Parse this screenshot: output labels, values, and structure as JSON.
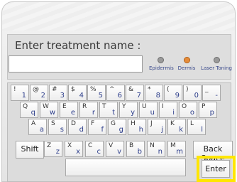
{
  "header": {
    "title": "Enter treatment name :",
    "input_value": "",
    "modes": [
      {
        "label": "Epidermis",
        "active": false
      },
      {
        "label": "Dermis",
        "active": true
      },
      {
        "label": "Laser Toning",
        "active": false
      }
    ]
  },
  "keyboard": {
    "row1": [
      {
        "shift": "!",
        "main": "1"
      },
      {
        "shift": "@",
        "main": "2"
      },
      {
        "shift": "#",
        "main": "3"
      },
      {
        "shift": "$",
        "main": "4"
      },
      {
        "shift": "%",
        "main": "5"
      },
      {
        "shift": "^",
        "main": "6"
      },
      {
        "shift": "&",
        "main": "7"
      },
      {
        "shift": "*",
        "main": "8"
      },
      {
        "shift": "(",
        "main": "9"
      },
      {
        "shift": ")",
        "main": "0"
      },
      {
        "shift": "_",
        "main": "-"
      }
    ],
    "row2": [
      {
        "shift": "Q",
        "main": "q"
      },
      {
        "shift": "W",
        "main": "w"
      },
      {
        "shift": "E",
        "main": "e"
      },
      {
        "shift": "R",
        "main": "r"
      },
      {
        "shift": "T",
        "main": "t"
      },
      {
        "shift": "Y",
        "main": "y"
      },
      {
        "shift": "U",
        "main": "u"
      },
      {
        "shift": "I",
        "main": "i"
      },
      {
        "shift": "O",
        "main": "o"
      },
      {
        "shift": "P",
        "main": "p"
      }
    ],
    "row3": [
      {
        "shift": "A",
        "main": "a"
      },
      {
        "shift": "S",
        "main": "s"
      },
      {
        "shift": "D",
        "main": "d"
      },
      {
        "shift": "F",
        "main": "f"
      },
      {
        "shift": "G",
        "main": "g"
      },
      {
        "shift": "H",
        "main": "h"
      },
      {
        "shift": "J",
        "main": "j"
      },
      {
        "shift": "K",
        "main": "k"
      },
      {
        "shift": "L",
        "main": "l"
      }
    ],
    "row4": [
      {
        "shift": "Z",
        "main": "z"
      },
      {
        "shift": "X",
        "main": "x"
      },
      {
        "shift": "C",
        "main": "c"
      },
      {
        "shift": "V",
        "main": "v"
      },
      {
        "shift": "B",
        "main": "b"
      },
      {
        "shift": "N",
        "main": "n"
      },
      {
        "shift": "M",
        "main": "m"
      }
    ],
    "shift_label": "Shift",
    "backspace_label": "Back Space",
    "enter_label": "Enter"
  },
  "colors": {
    "highlight": "#ffe600",
    "active_mode": "#e58c3a",
    "key_text": "#2e3f8c"
  }
}
